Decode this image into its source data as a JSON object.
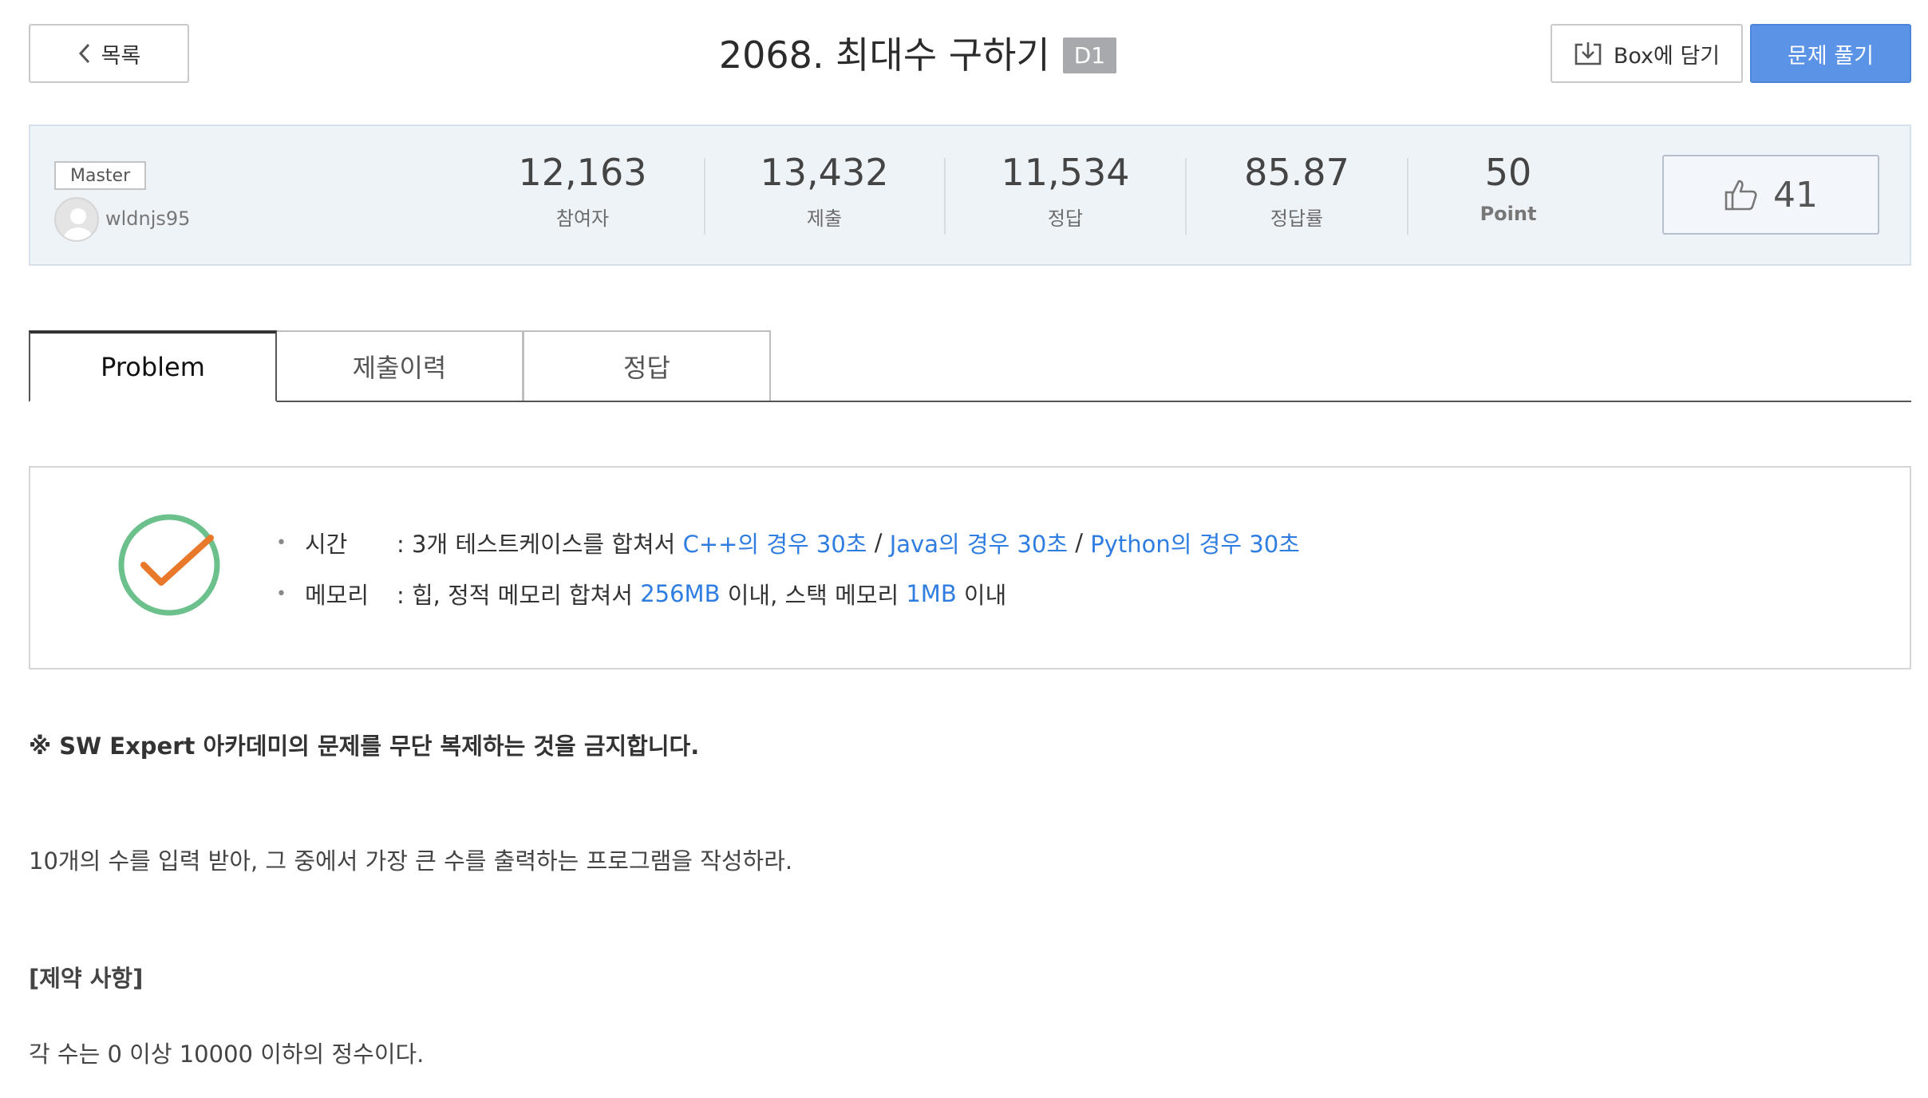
{
  "header": {
    "back_label": "목록",
    "problem_title": "2068. 최대수 구하기",
    "level": "D1",
    "box_label": "Box에 담기",
    "solve_label": "문제 풀기"
  },
  "author": {
    "badge": "Master",
    "username": "wldnjs95"
  },
  "stats": {
    "participants": {
      "value": "12,163",
      "label": "참여자"
    },
    "submissions": {
      "value": "13,432",
      "label": "제출"
    },
    "correct": {
      "value": "11,534",
      "label": "정답"
    },
    "rate": {
      "value": "85.87",
      "label": "정답률"
    },
    "point": {
      "value": "50",
      "label": "Point"
    },
    "likes": "41"
  },
  "tabs": [
    {
      "label": "Problem",
      "active": true
    },
    {
      "label": "제출이력",
      "active": false
    },
    {
      "label": "정답",
      "active": false
    }
  ],
  "limits": {
    "time_key": "시간",
    "time_prefix": ": 3개 테스트케이스를 합쳐서 ",
    "time_cpp": "C++의 경우 30초",
    "sep1": " / ",
    "time_java": "Java의 경우 30초",
    "sep2": " / ",
    "time_python": "Python의 경우 30초",
    "memory_key": "메모리",
    "memory_prefix": ": 힙, 정적 메모리 합쳐서 ",
    "memory_heap": "256MB",
    "memory_mid": " 이내, 스택 메모리 ",
    "memory_stack": "1MB",
    "memory_suffix": " 이내"
  },
  "content": {
    "notice": "※ SW Expert 아카데미의 문제를 무단 복제하는 것을 금지합니다.",
    "description": "10개의 수를 입력 받아, 그 중에서 가장 큰 수를 출력하는 프로그램을 작성하라.",
    "constraint_heading": "[제약 사항]",
    "constraint_text": "각 수는 0 이상 10000 이하의 정수이다."
  },
  "colors": {
    "accent_blue": "#2f7de1",
    "solve_button": "#5b93e6",
    "check_green": "#6cc08b",
    "check_orange": "#e8782a"
  }
}
